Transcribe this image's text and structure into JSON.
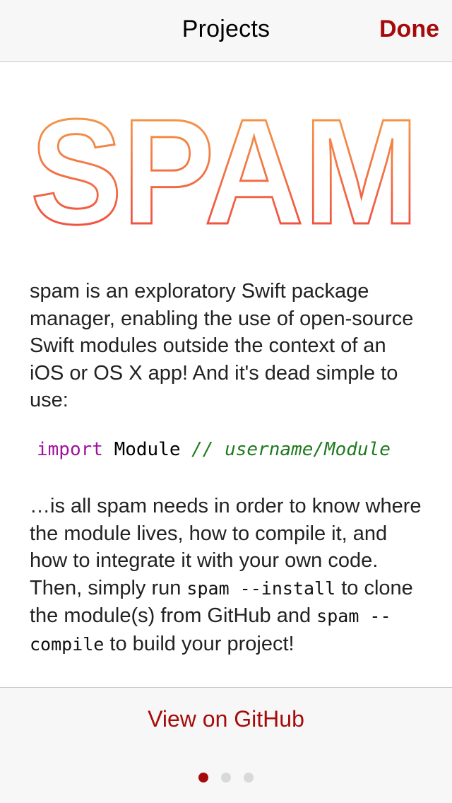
{
  "nav": {
    "title": "Projects",
    "done_label": "Done"
  },
  "logo": {
    "text": "SPAM",
    "gradient_top": "#f5a84a",
    "gradient_bottom": "#ef4040"
  },
  "content": {
    "para1": "spam is an exploratory Swift package manager, enabling the use of open-source Swift modules outside the context of an iOS or OS X app! And it's dead simple to use:",
    "code": {
      "keyword": "import",
      "module": "Module",
      "comment": "// username/Module"
    },
    "para2": {
      "part1": "…is all spam needs in order to know where the module lives, how to compile it, and how to integrate it with your own code. Then, simply run ",
      "code1": "spam --install",
      "part2": " to clone the module(s) from GitHub and ",
      "code2": "spam --compile",
      "part3": " to build your project!"
    }
  },
  "bottom": {
    "github_label": "View on GitHub",
    "page_control": {
      "pages": 3,
      "current": 1
    }
  },
  "colors": {
    "accent": "#a60b0b",
    "keyword": "#a0139e",
    "comment": "#1f7a1f"
  }
}
